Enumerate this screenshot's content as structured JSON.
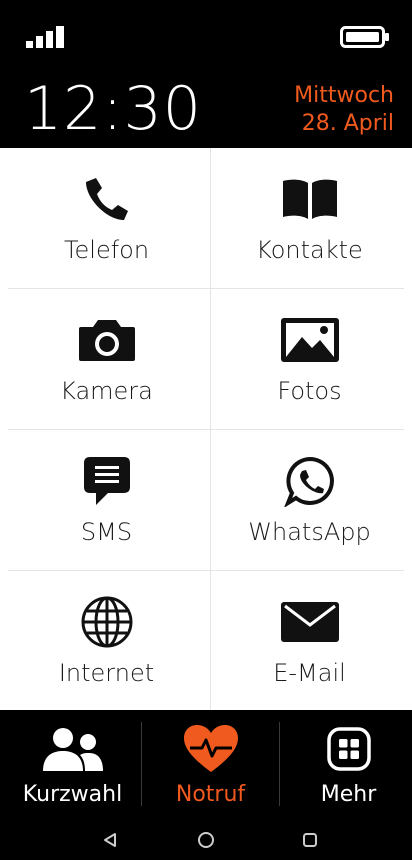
{
  "status": {
    "time": "12:30",
    "weekday": "Mittwoch",
    "date": "28. April",
    "signal_icon": "signal-bars-icon",
    "battery_icon": "battery-full-icon"
  },
  "tiles": [
    {
      "label": "Telefon",
      "icon": "phone-icon"
    },
    {
      "label": "Kontakte",
      "icon": "contacts-book-icon"
    },
    {
      "label": "Kamera",
      "icon": "camera-icon"
    },
    {
      "label": "Fotos",
      "icon": "photos-icon"
    },
    {
      "label": "SMS",
      "icon": "sms-bubble-icon"
    },
    {
      "label": "WhatsApp",
      "icon": "whatsapp-icon"
    },
    {
      "label": "Internet",
      "icon": "globe-icon"
    },
    {
      "label": "E-Mail",
      "icon": "envelope-icon"
    }
  ],
  "bottom_nav": [
    {
      "label": "Kurzwahl",
      "icon": "people-icon"
    },
    {
      "label": "Notruf",
      "icon": "heart-pulse-icon"
    },
    {
      "label": "Mehr",
      "icon": "grid-menu-icon"
    }
  ],
  "system_nav": [
    "back-triangle-icon",
    "home-circle-icon",
    "recents-square-icon"
  ],
  "colors": {
    "accent": "#f05a1e",
    "background_dark": "#000000",
    "tile_background": "#ffffff",
    "divider": "#e4e4e4"
  }
}
